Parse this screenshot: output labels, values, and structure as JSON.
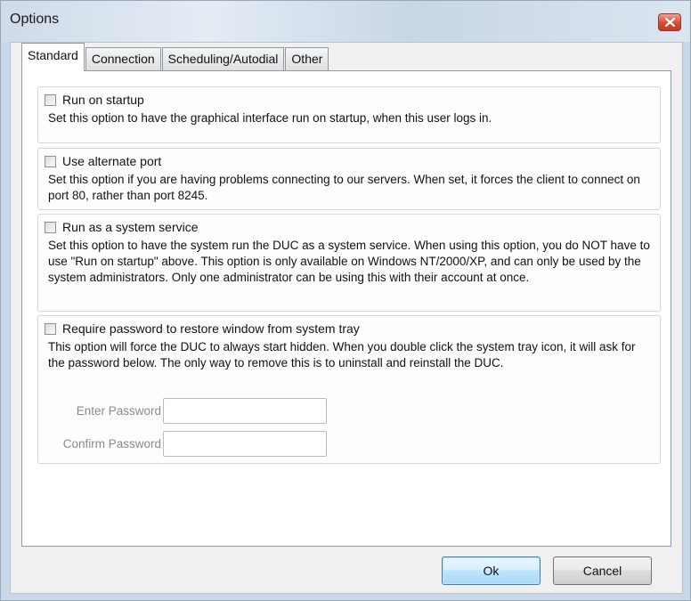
{
  "window": {
    "title": "Options"
  },
  "tabs": [
    "Standard",
    "Connection",
    "Scheduling/Autodial",
    "Other"
  ],
  "options": [
    {
      "label": "Run on startup",
      "checked": false,
      "description": "Set this option to have the graphical interface run on startup, when this user logs in."
    },
    {
      "label": "Use alternate port",
      "checked": false,
      "description": "Set this option if you are having problems connecting to our servers.  When set, it forces the client to connect on port 80, rather than port 8245."
    },
    {
      "label": "Run as a system service",
      "checked": false,
      "description": "Set this option to have the system run the DUC as a system service.  When using this option, you do NOT have to use \"Run on startup\" above.  This option is only available on Windows NT/2000/XP, and can only be used by the system administrators.  Only one administrator can be using this with their account at once."
    },
    {
      "label": "Require password to restore window from system tray",
      "checked": false,
      "description": "This option will force the DUC to always start hidden.  When you double click the system tray icon, it will ask for the password below.  The only way to remove this is to uninstall and reinstall the DUC."
    }
  ],
  "password": {
    "enter_label": "Enter Password",
    "enter_value": "",
    "confirm_label": "Confirm Password",
    "confirm_value": ""
  },
  "buttons": {
    "ok": "Ok",
    "cancel": "Cancel"
  },
  "colors": {
    "accent": "#3c7fb1",
    "close": "#d64b32"
  },
  "icons": {
    "close": "close-icon"
  }
}
